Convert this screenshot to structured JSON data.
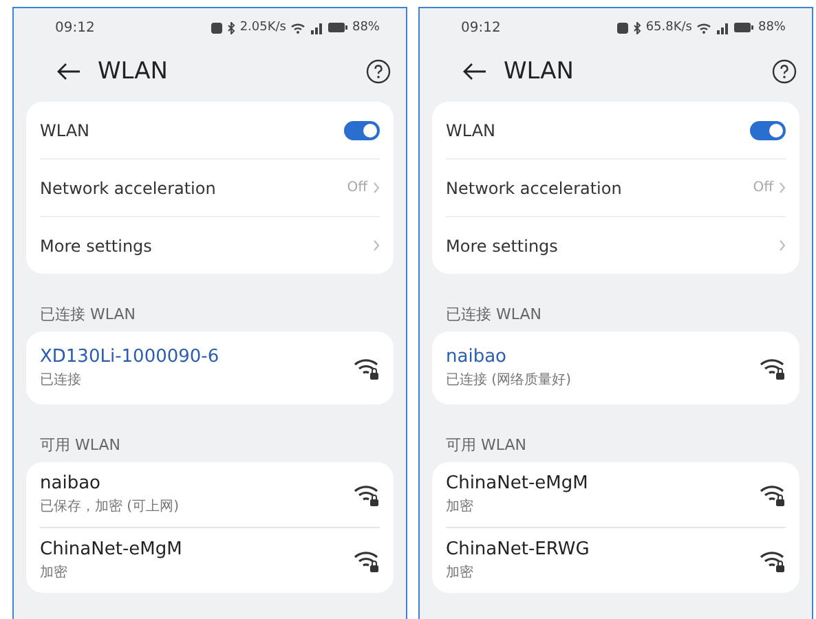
{
  "panels": [
    {
      "status_bar": {
        "time": "09:12",
        "net_speed": "2.05K/s",
        "battery": "88%"
      },
      "title": "WLAN",
      "settings": [
        {
          "kind": "toggle",
          "label": "WLAN",
          "on": true
        },
        {
          "kind": "link",
          "label": "Network acceleration",
          "value": "Off"
        },
        {
          "kind": "link",
          "label": "More settings"
        }
      ],
      "connected_header": "已连接 WLAN",
      "connected": {
        "name": "XD130Li-1000090-6",
        "status": "已连接"
      },
      "available_header": "可用 WLAN",
      "available": [
        {
          "name": "naibao",
          "status": "已保存，加密 (可上网)"
        },
        {
          "name": "ChinaNet-eMgM",
          "status": "加密"
        }
      ]
    },
    {
      "status_bar": {
        "time": "09:12",
        "net_speed": "65.8K/s",
        "battery": "88%"
      },
      "title": "WLAN",
      "settings": [
        {
          "kind": "toggle",
          "label": "WLAN",
          "on": true
        },
        {
          "kind": "link",
          "label": "Network acceleration",
          "value": "Off"
        },
        {
          "kind": "link",
          "label": "More settings"
        }
      ],
      "connected_header": "已连接 WLAN",
      "connected": {
        "name": "naibao",
        "status": "已连接 (网络质量好)"
      },
      "available_header": "可用 WLAN",
      "available": [
        {
          "name": "ChinaNet-eMgM",
          "status": "加密"
        },
        {
          "name": "ChinaNet-ERWG",
          "status": "加密"
        }
      ]
    }
  ]
}
